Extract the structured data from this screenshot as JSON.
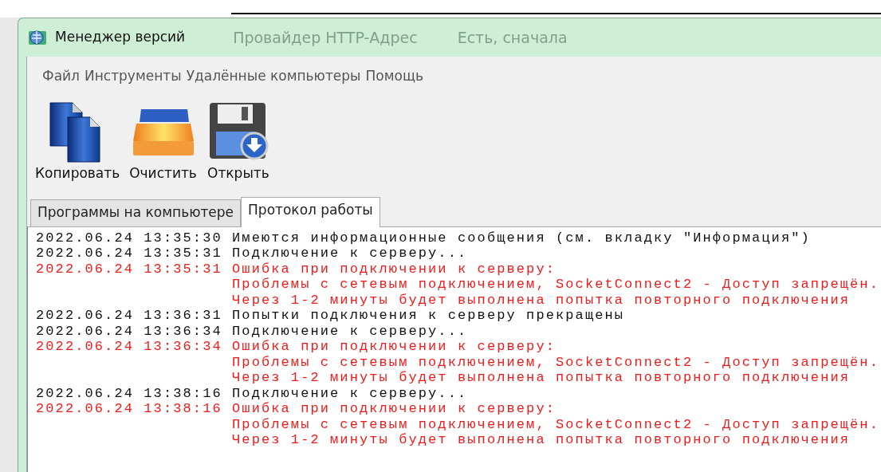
{
  "window": {
    "title": "Менеджер версий"
  },
  "background_window": {
    "texts": [
      "Провайдер HTTP-Адрес",
      "Есть, сначала"
    ]
  },
  "menu": [
    "Файл",
    "Инструменты",
    "Удалённые компьютеры",
    "Помощь"
  ],
  "toolbar": [
    {
      "kind": "copy",
      "label": "Копировать"
    },
    {
      "kind": "clear",
      "label": "Очистить"
    },
    {
      "kind": "open",
      "label": "Открыть"
    }
  ],
  "tabs": [
    {
      "label": "Программы на компьютере",
      "selected": false
    },
    {
      "label": "Протокол работы",
      "selected": true
    }
  ],
  "log": [
    {
      "kind": "info",
      "time": "2022.06.24 13:35:30",
      "lines": [
        "Имеются информационные сообщения (см. вкладку \"Информация\")"
      ]
    },
    {
      "kind": "info",
      "time": "2022.06.24 13:35:31",
      "lines": [
        "Подключение к серверу..."
      ]
    },
    {
      "kind": "error",
      "time": "2022.06.24 13:35:31",
      "lines": [
        "Ошибка при подключении к серверу:",
        "Проблемы с сетевым подключением, SocketConnect2 - Доступ запрещён.",
        "Через 1-2 минуты будет выполнена попытка повторного подключения"
      ]
    },
    {
      "kind": "info",
      "time": "2022.06.24 13:36:31",
      "lines": [
        "Попытки подключения к серверу прекращены"
      ]
    },
    {
      "kind": "info",
      "time": "2022.06.24 13:36:34",
      "lines": [
        "Подключение к серверу..."
      ]
    },
    {
      "kind": "error",
      "time": "2022.06.24 13:36:34",
      "lines": [
        "Ошибка при подключении к серверу:",
        "Проблемы с сетевым подключением, SocketConnect2 - Доступ запрещён.",
        "Через 1-2 минуты будет выполнена попытка повторного подключения"
      ]
    },
    {
      "kind": "info",
      "time": "2022.06.24 13:38:16",
      "lines": [
        "Подключение к серверу..."
      ]
    },
    {
      "kind": "error",
      "time": "2022.06.24 13:38:16",
      "lines": [
        "Ошибка при подключении к серверу:",
        "Проблемы с сетевым подключением, SocketConnect2 - Доступ запрещён.",
        "Через 1-2 минуты будет выполнена попытка повторного подключения"
      ]
    }
  ]
}
